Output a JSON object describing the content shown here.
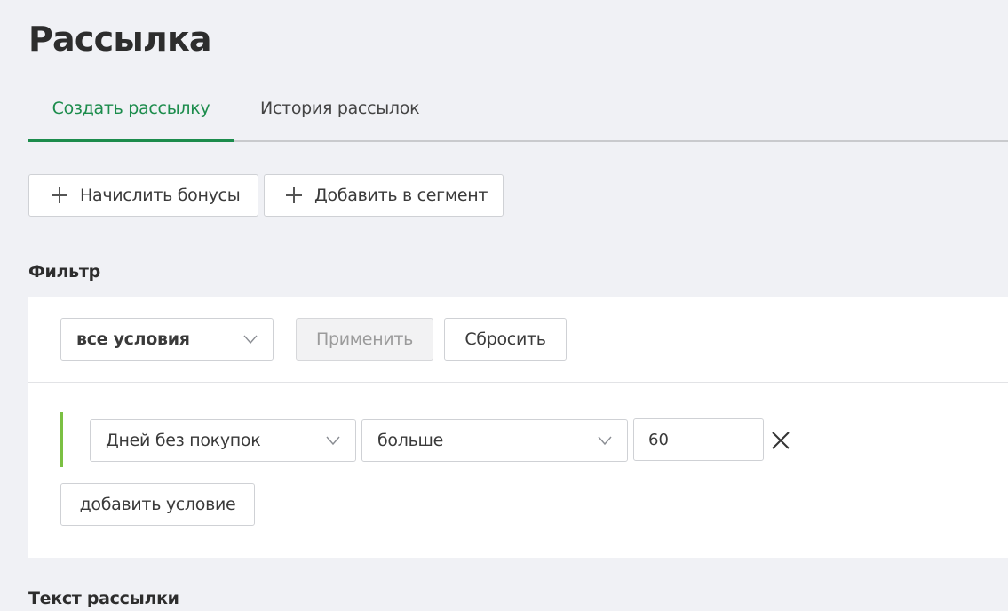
{
  "page": {
    "title": "Рассылка"
  },
  "tabs": [
    {
      "label": "Создать рассылку",
      "active": true
    },
    {
      "label": "История рассылок",
      "active": false
    }
  ],
  "actions": {
    "accrue_bonuses_label": "Начислить бонусы",
    "add_to_segment_label": "Добавить в сегмент",
    "icon": "plus-icon"
  },
  "filter": {
    "title": "Фильтр",
    "logic_select": "все условия",
    "apply_label": "Применить",
    "reset_label": "Сбросить",
    "conditions": [
      {
        "field": "Дней без покупок",
        "operator": "больше",
        "value": "60",
        "remove_icon": "close-icon"
      }
    ],
    "add_condition_label": "добавить условие"
  },
  "message_text": {
    "title": "Текст рассылки"
  },
  "colors": {
    "accent": "#1c8c4c",
    "condition_bar": "#7bc043",
    "background": "#f0f1f5"
  }
}
